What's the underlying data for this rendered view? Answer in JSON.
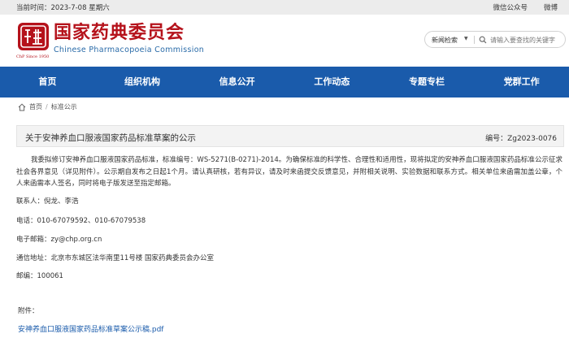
{
  "topbar": {
    "date": "当前时间：2023-7-08 星期六",
    "wechat": "微信公众号",
    "weibo": "微博"
  },
  "header": {
    "logo_cn": "国家药典委员会",
    "logo_en": "Chinese Pharmacopoeia Commission",
    "logo_year": "ChP Since 1950"
  },
  "search": {
    "select_label": "新闻检索",
    "placeholder": "请输入要查找的关键字"
  },
  "nav": {
    "items": [
      "首页",
      "组织机构",
      "信息公开",
      "工作动态",
      "专题专栏",
      "党群工作"
    ]
  },
  "breadcrumb": {
    "home": "首页",
    "separator": "/",
    "current": "标准公示"
  },
  "article": {
    "title": "关于安神养血口服液国家药品标准草案的公示",
    "number": "编号：Zg2023-0076",
    "body": "我委拟修订安神养血口服液国家药品标准，标准编号：WS-5271(B-0271)-2014。为确保标准的科学性、合理性和适用性，现将拟定的安神养血口服液国家药品标准公示征求社会各界意见（详见附件）。公示期自发布之日起1个月。请认真研核，若有异议，请及时来函提交反馈意见，并附相关说明、实验数据和联系方式。相关单位来函需加盖公章，个人来函需本人签名，同时将电子版发送至指定邮箱。",
    "contact": "联系人：倪龙、李浩",
    "phone": "电话：010-67079592、010-67079538",
    "email": "电子邮箱：zy@chp.org.cn",
    "address": "通信地址：北京市东城区法华南里11号楼 国家药典委员会办公室",
    "postcode": "邮编：100061",
    "attachment_label": "附件：",
    "attachment_link": "安神养血口服液国家药品标准草案公示稿.pdf"
  },
  "colors": {
    "brand_red": "#b5121b",
    "nav_blue": "#1a5bab",
    "link_blue": "#1a5bab"
  }
}
